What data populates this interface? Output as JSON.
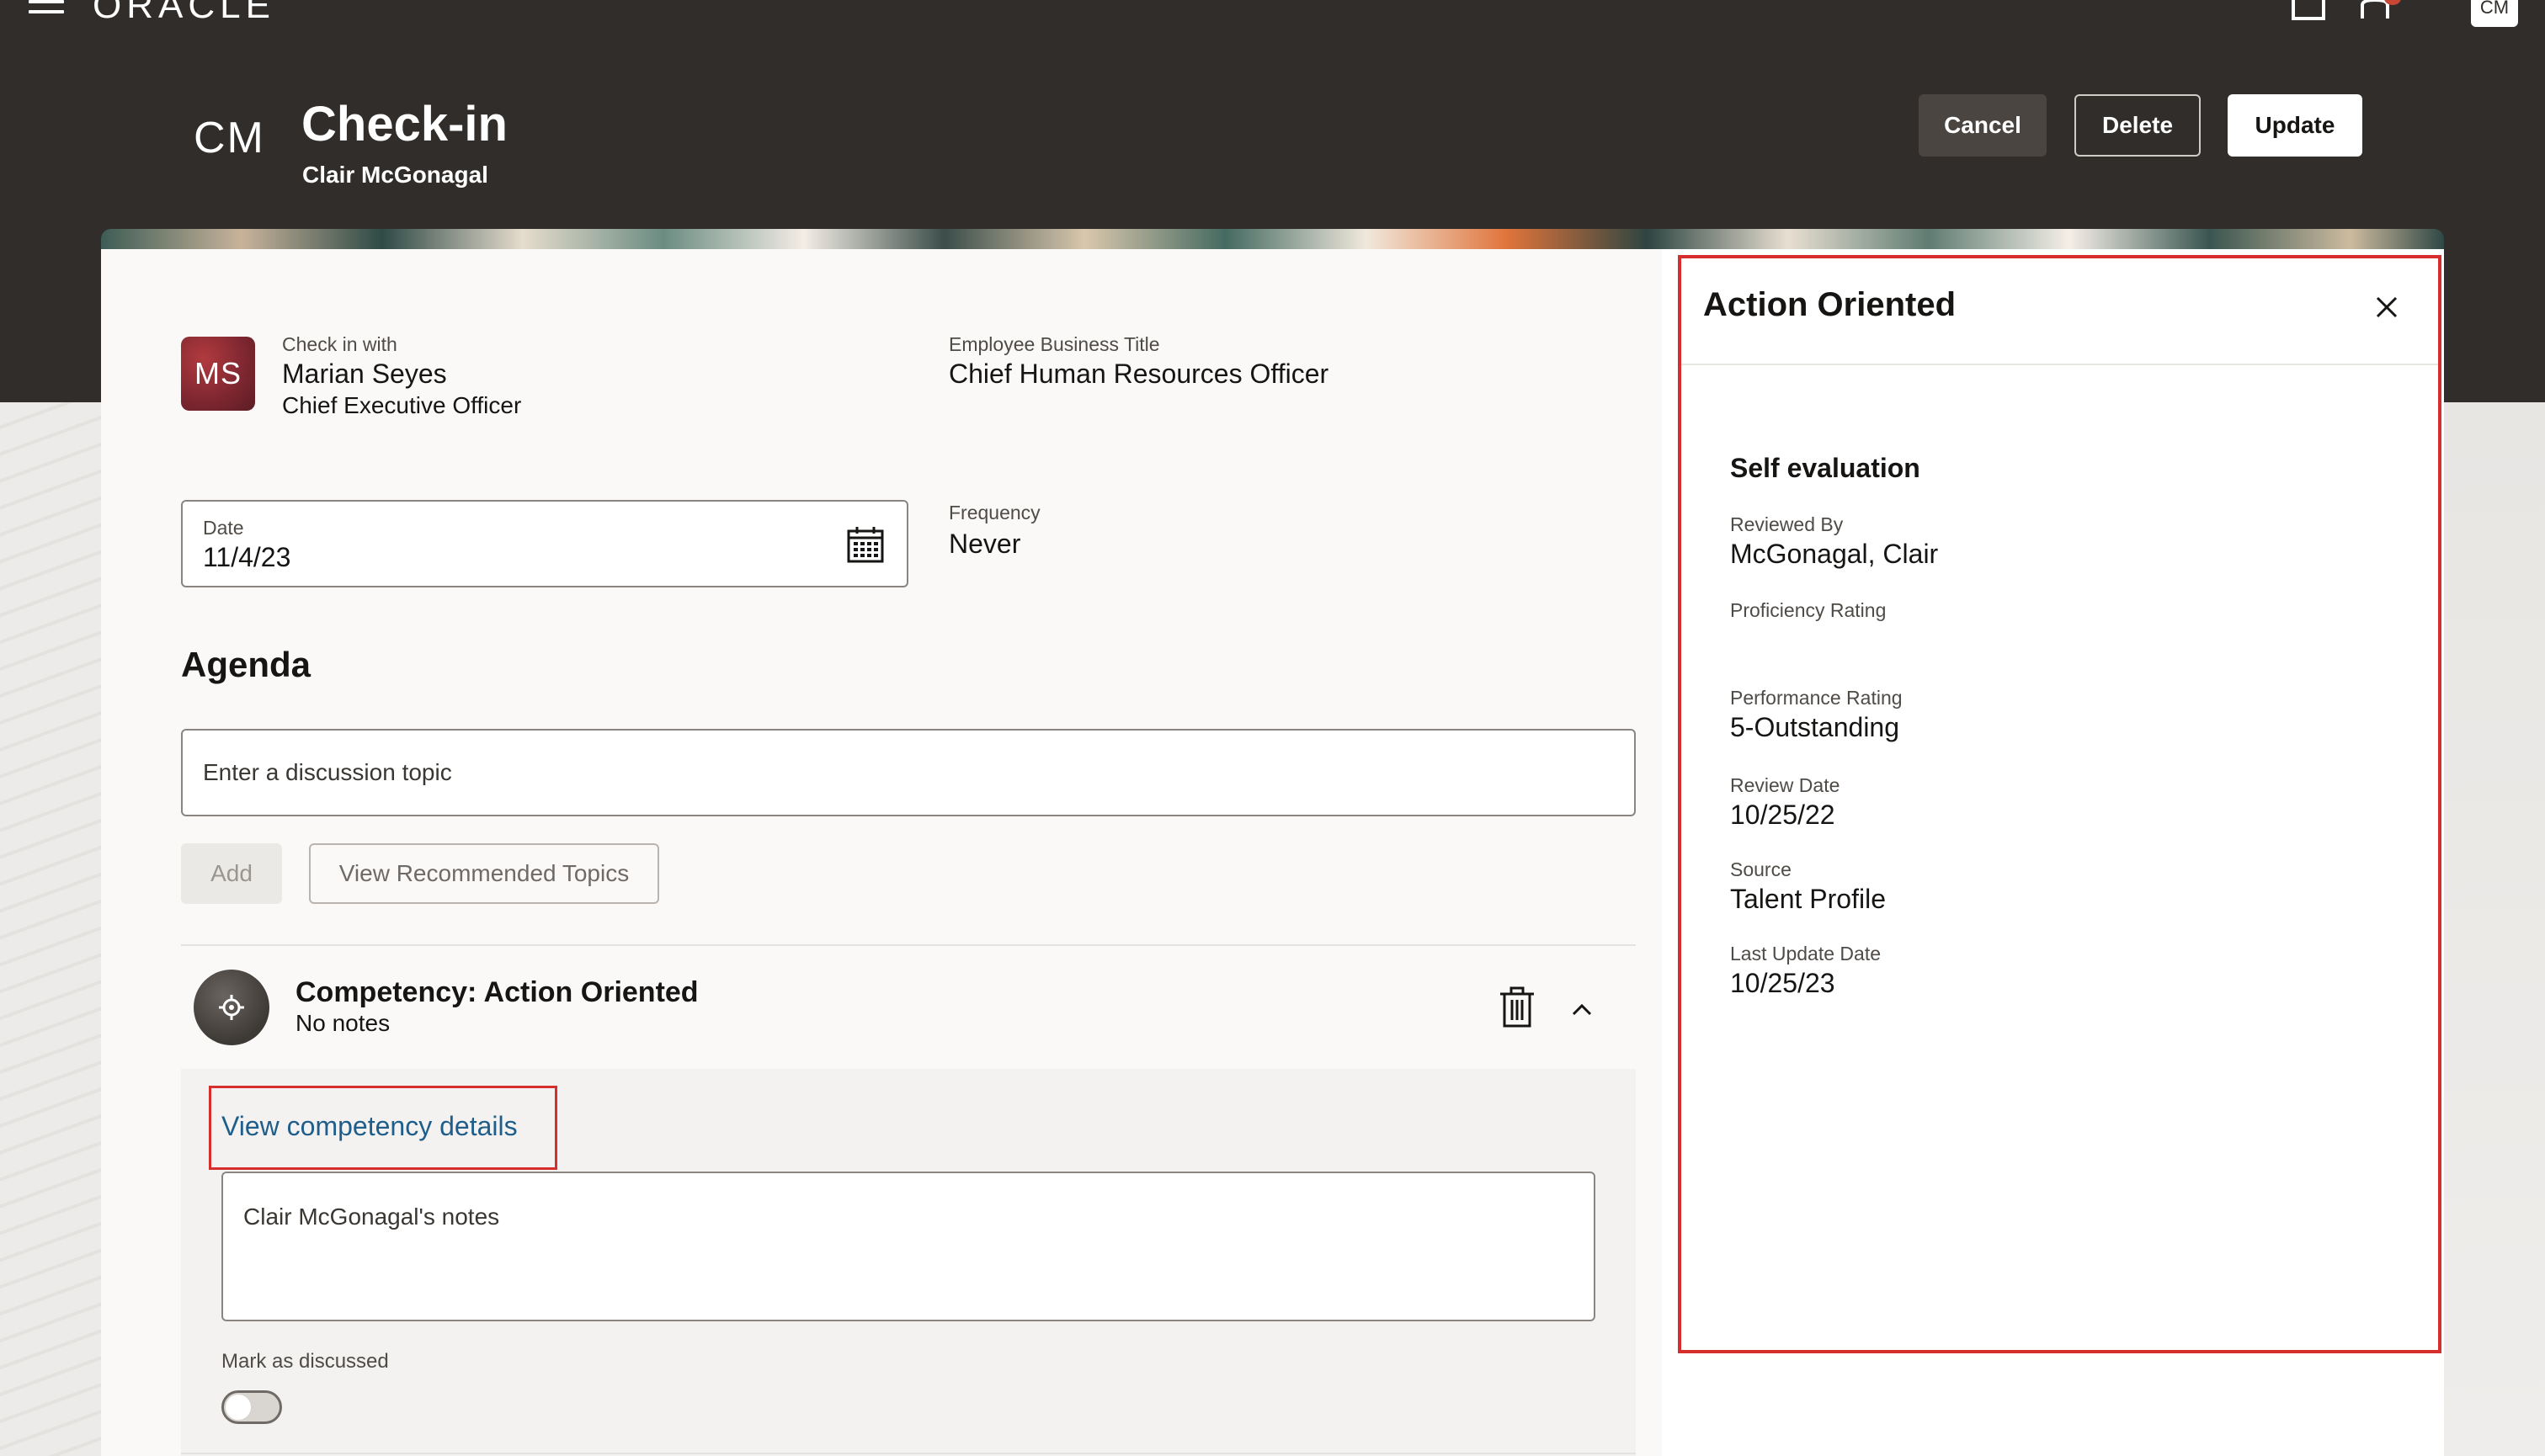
{
  "global_header": {
    "brand": "ORACLE",
    "user_initials": "CM"
  },
  "page_header": {
    "initials": "CM",
    "title": "Check-in",
    "subtitle": "Clair McGonagal",
    "buttons": {
      "cancel": "Cancel",
      "delete": "Delete",
      "update": "Update"
    }
  },
  "checkin": {
    "with_label": "Check in with",
    "avatar_initials": "MS",
    "with_name": "Marian Seyes",
    "with_title": "Chief Executive Officer",
    "business_title_label": "Employee Business Title",
    "business_title_value": "Chief Human Resources Officer",
    "date_label": "Date",
    "date_value": "11/4/23",
    "frequency_label": "Frequency",
    "frequency_value": "Never"
  },
  "agenda": {
    "title": "Agenda",
    "topic_placeholder": "Enter a discussion topic",
    "add_button": "Add",
    "view_recommended_button": "View Recommended Topics",
    "item": {
      "title": "Competency: Action Oriented",
      "notes_summary": "No notes",
      "view_details_link": "View competency details",
      "notes_placeholder": "Clair McGonagal's notes",
      "mark_discussed_label": "Mark as discussed",
      "mark_discussed": false
    }
  },
  "side_panel": {
    "title": "Action Oriented",
    "section_title": "Self evaluation",
    "fields": [
      {
        "label": "Reviewed By",
        "value": "McGonagal, Clair"
      },
      {
        "label": "Proficiency Rating",
        "value": ""
      },
      {
        "label": "Performance Rating",
        "value": "5-Outstanding"
      },
      {
        "label": "Review Date",
        "value": "10/25/22"
      },
      {
        "label": "Source",
        "value": "Talent Profile"
      },
      {
        "label": "Last Update Date",
        "value": "10/25/23"
      }
    ]
  },
  "colors": {
    "header_bg": "#312d2a",
    "link": "#1f5e8a",
    "highlight": "#d62d2d",
    "notification": "#c74634"
  }
}
